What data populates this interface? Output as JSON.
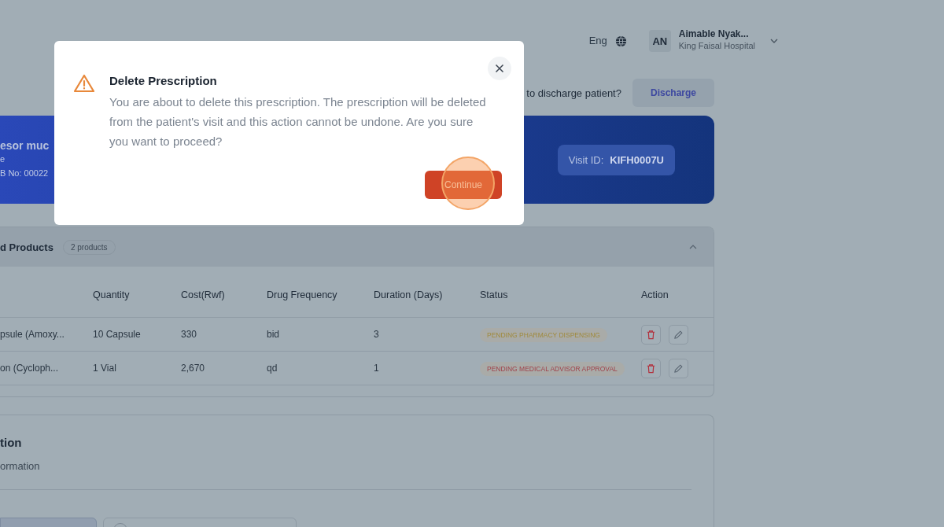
{
  "header": {
    "language": "Eng",
    "user": {
      "initials": "AN",
      "name": "Aimable Nyak...",
      "hospital": "King Faisal Hospital"
    }
  },
  "discharge": {
    "prompt": "to discharge patient?",
    "button": "Discharge"
  },
  "patient": {
    "name": "esor muc",
    "line_1": "e",
    "line_2": "B No: 00022",
    "visit_label": "Visit ID:",
    "visit_id": "KIFH0007U"
  },
  "products": {
    "title": "d Products",
    "count": "2 products",
    "expanded": true,
    "columns": [
      "Quantity",
      "Cost(Rwf)",
      "Drug Frequency",
      "Duration (Days)",
      "Status",
      "Action"
    ],
    "rows": [
      {
        "name": "psule (Amoxy...",
        "quantity": "10 Capsule",
        "cost": "330",
        "frequency": "bid",
        "duration": "3",
        "status": "PENDING PHARMACY DISPENSING",
        "color": "#a08a3c"
      },
      {
        "name": "on (Cycloph...",
        "quantity": "1 Vial",
        "cost": "2,670",
        "frequency": "qd",
        "duration": "1",
        "status": "PENDING MEDICAL ADVISOR APPROVAL",
        "color": "#a0424a"
      }
    ]
  },
  "section": {
    "title": "tion",
    "subtitle": "ormation",
    "options": [
      {
        "selected": true
      },
      {
        "selected": false
      }
    ]
  },
  "dialog": {
    "title": "Delete Prescription",
    "message": "You are about to delete this prescription. The prescription will be deleted from the patient's visit and this action cannot be undone. Are you sure you want to proceed?",
    "confirm": "Continue"
  }
}
